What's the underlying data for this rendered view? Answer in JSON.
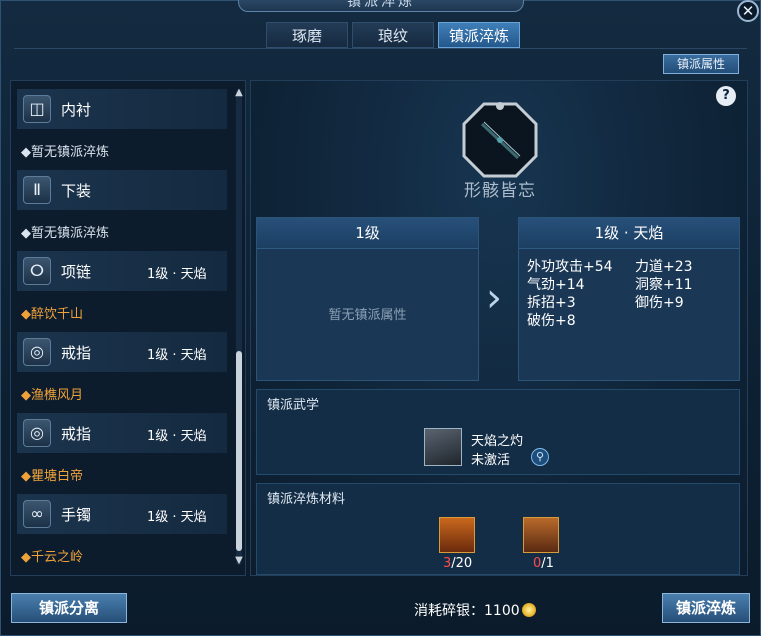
{
  "window": {
    "title": "镇派淬炼",
    "close_icon": "close-icon"
  },
  "tabs": [
    {
      "label": "琢磨",
      "active": false
    },
    {
      "label": "琅纹",
      "active": false
    },
    {
      "label": "镇派淬炼",
      "active": true
    }
  ],
  "attr_button": "镇派属性",
  "slots": [
    {
      "icon": "inner-shirt-icon",
      "name": "内衬",
      "level": "",
      "sub": "◆暂无镇派淬炼",
      "sub_highlight": false
    },
    {
      "icon": "pants-icon",
      "name": "下装",
      "level": "",
      "sub": "◆暂无镇派淬炼",
      "sub_highlight": false
    },
    {
      "icon": "necklace-icon",
      "name": "项链",
      "level": "1级 · 天焰",
      "sub": "◆醉饮千山",
      "sub_highlight": true
    },
    {
      "icon": "ring-icon",
      "name": "戒指",
      "level": "1级 · 天焰",
      "sub": "◆渔樵风月",
      "sub_highlight": true
    },
    {
      "icon": "ring-icon",
      "name": "戒指",
      "level": "1级 · 天焰",
      "sub": "◆瞿塘白帝",
      "sub_highlight": true
    },
    {
      "icon": "bracelet-icon",
      "name": "手镯",
      "level": "1级 · 天焰",
      "sub": "◆千云之岭",
      "sub_highlight": true
    }
  ],
  "equip": {
    "title": "形骸皆忘"
  },
  "current": {
    "header": "1级",
    "empty": "暂无镇派属性"
  },
  "next": {
    "header": "1级 · 天焰",
    "stats": [
      "外功攻击+54",
      "力道+23",
      "气劲+14",
      "洞察+11",
      "拆招+3",
      "御伤+9",
      "破伤+8"
    ]
  },
  "skill_section": {
    "title": "镇派武学",
    "skill_name": "天焰之灼",
    "skill_state": "未激活"
  },
  "material_section": {
    "title": "镇派淬炼材料",
    "materials": [
      {
        "have": "3",
        "need": "/20"
      },
      {
        "have": "0",
        "need": "/1"
      }
    ]
  },
  "footer": {
    "separate_button": "镇派分离",
    "cost_label": "消耗碎银：",
    "cost_value": "1100",
    "refine_button": "镇派淬炼"
  },
  "colors": {
    "highlight": "#f0a23a",
    "insufficient": "#ff4a4a",
    "active_tab": "#3f7fb8"
  }
}
